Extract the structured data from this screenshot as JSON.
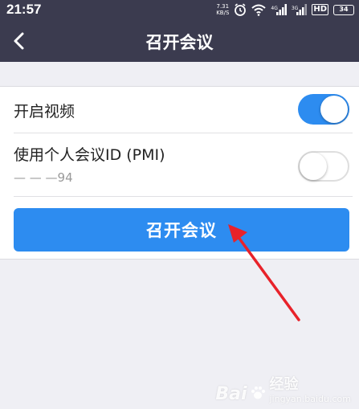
{
  "status_bar": {
    "time": "21:57",
    "net_speed_value": "7.31",
    "net_speed_unit": "KB/S",
    "sim1_label": "4G",
    "sim2_label": "3G",
    "hd_label": "HD",
    "battery": "34"
  },
  "navbar": {
    "back_icon": "chevron-left-icon",
    "title": "召开会议"
  },
  "settings": {
    "video": {
      "label": "开启视频",
      "enabled": true
    },
    "pmi": {
      "label": "使用个人会议ID (PMI)",
      "value": "— — —94",
      "enabled": false
    }
  },
  "actions": {
    "start_button_label": "召开会议"
  },
  "annotation": {
    "arrow_color": "#e8222a"
  },
  "watermark": {
    "brand": "Bai",
    "suffix": "经验",
    "sub": "jingyan.baidu.com"
  },
  "colors": {
    "nav_bg": "#3b3b4f",
    "accent": "#2d8cf0",
    "page_bg": "#efeff4"
  }
}
